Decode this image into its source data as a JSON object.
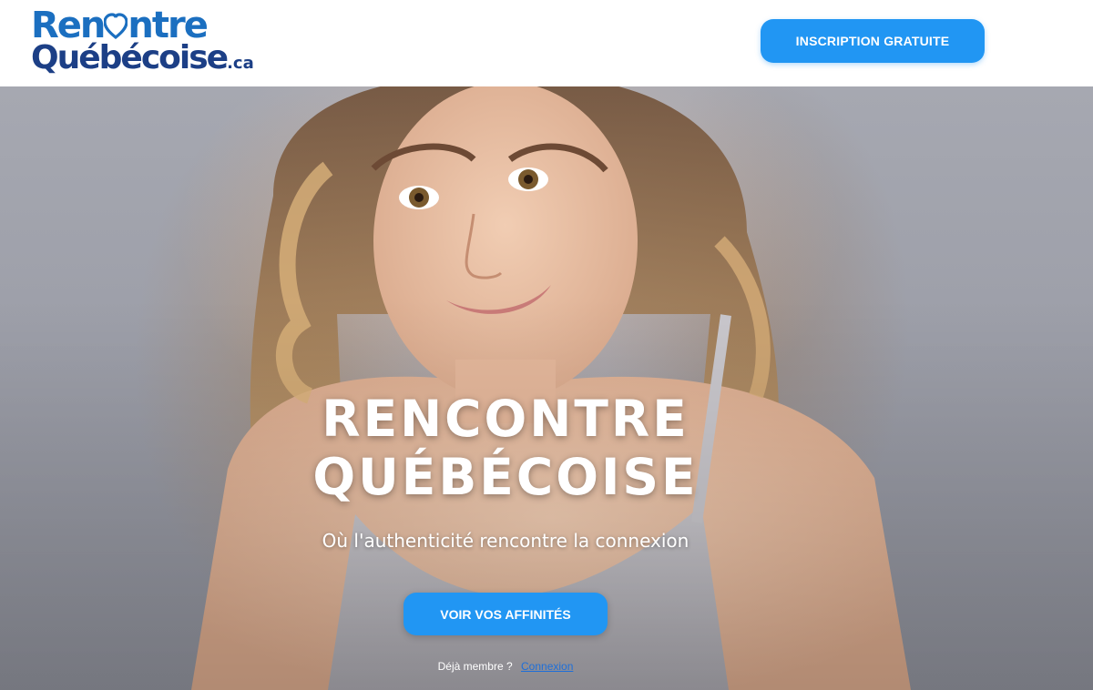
{
  "header": {
    "logo": {
      "line1_part1": "Ren",
      "line1_part2": "ntre",
      "line2": "Québécoise",
      "tld": ".ca",
      "heart_icon": "heart-icon",
      "color_primary": "#1b6fc0",
      "color_secondary": "#1c3f86"
    },
    "signup_label": "INSCRIPTION GRATUITE"
  },
  "hero": {
    "title_line1": "RENCONTRE",
    "title_line2": "QUÉBÉCOISE",
    "subtitle": "Où l'authenticité rencontre la connexion",
    "cta_label": "VOIR VOS AFFINITÉS",
    "member_text": "Déjà membre ?",
    "login_label": "Connexion"
  },
  "colors": {
    "accent": "#2196f3",
    "link": "#1e6fd9"
  }
}
